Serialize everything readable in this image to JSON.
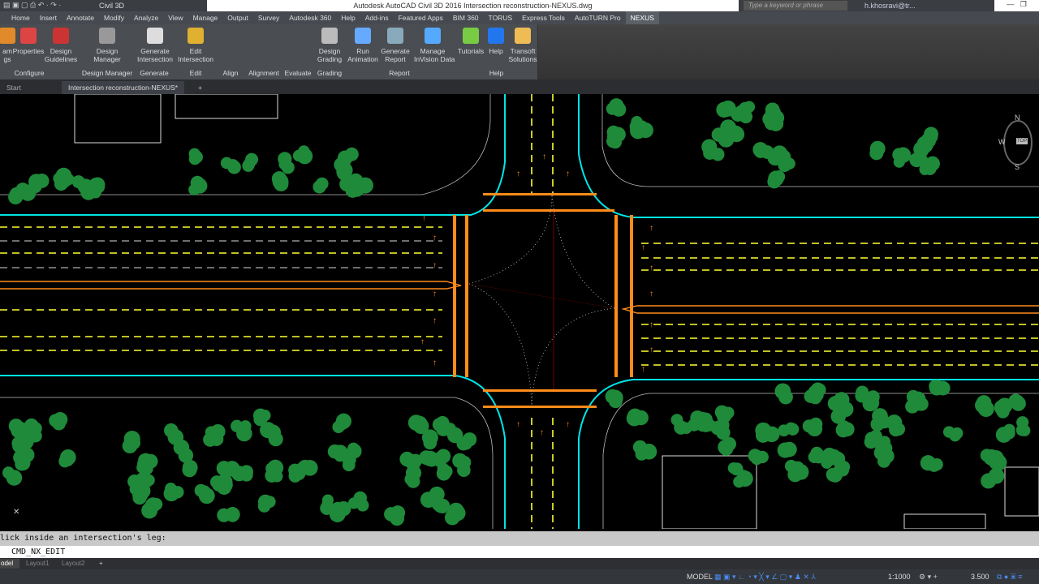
{
  "titlebar": {
    "app_workspace": "Civil 3D",
    "title": "Autodesk AutoCAD Civil 3D 2016    Intersection reconstruction-NEXUS.dwg",
    "search_placeholder": "Type a keyword or phrase",
    "user": "h.khosravi@tr..."
  },
  "menu": [
    "Home",
    "Insert",
    "Annotate",
    "Modify",
    "Analyze",
    "View",
    "Manage",
    "Output",
    "Survey",
    "Autodesk 360",
    "Help",
    "Add-ins",
    "Featured Apps",
    "BIM 360",
    "TORUS",
    "Express Tools",
    "AutoTURN Pro",
    "NEXUS"
  ],
  "ribbon": {
    "buttons": [
      {
        "label": "am\ngs",
        "color": "#e08a2a"
      },
      {
        "label": "Properties",
        "color": "#d44"
      },
      {
        "label": "Design\nGuidelines",
        "color": "#c33"
      },
      {
        "label": "Design\nManager",
        "color": "#999"
      },
      {
        "label": "Generate\nIntersection",
        "color": "#ddd"
      },
      {
        "label": "Edit\nIntersection",
        "color": "#e0b030"
      },
      {
        "label": "Design\nGrading",
        "color": "#bbb"
      },
      {
        "label": "Run\nAnimation",
        "color": "#6af"
      },
      {
        "label": "Generate\nReport",
        "color": "#8ab"
      },
      {
        "label": "Manage\nInVision Data",
        "color": "#5af"
      },
      {
        "label": "Tutorials",
        "color": "#7c4"
      },
      {
        "label": "Help",
        "color": "#27e"
      },
      {
        "label": "Transoft\nSolutions",
        "color": "#eb5"
      }
    ],
    "panels": [
      "Configure",
      "Design Manager",
      "Generate",
      "Edit",
      "Align",
      "Alignment",
      "Evaluate",
      "Grading",
      "Report",
      "Help"
    ]
  },
  "file_tabs": {
    "start": "Start",
    "active": "Intersection reconstruction-NEXUS*"
  },
  "viewcube": {
    "n": "N",
    "s": "S",
    "w": "W",
    "top": "TOP"
  },
  "command": {
    "history": "lick inside an intersection's leg:",
    "input": "CMD_NX_EDIT"
  },
  "layout_tabs": [
    "odel",
    "Layout1",
    "Layout2"
  ],
  "status": {
    "model": "MODEL",
    "scale": "1:1000",
    "value": "3.500"
  },
  "colors": {
    "curb": "#00e5e5",
    "lane": "#ffff33",
    "markings": "#ff8c1a",
    "trees": "#1f8a3a"
  }
}
